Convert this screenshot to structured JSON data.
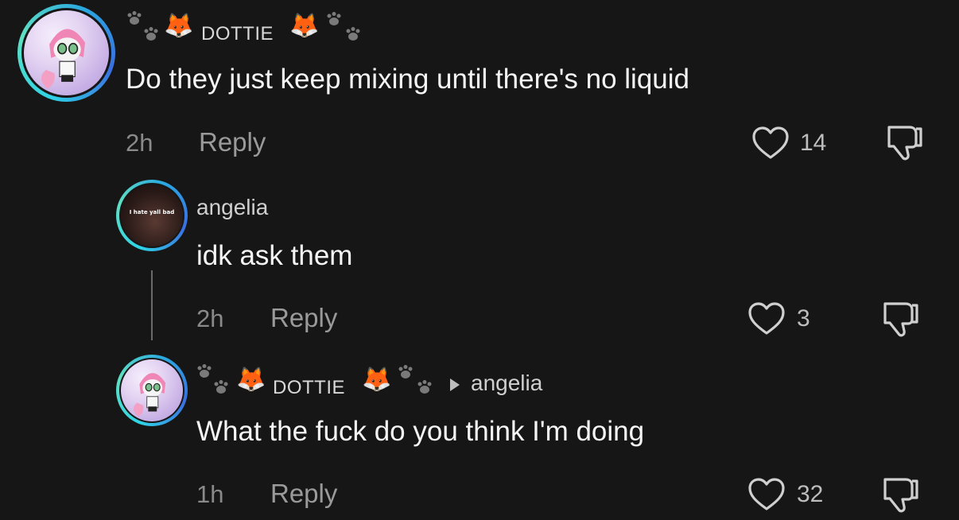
{
  "comments": [
    {
      "user": {
        "prefix_emoji": "🦊",
        "name": "DOTTIE",
        "suffix_emoji": "🦊"
      },
      "text": "Do they just keep mixing until there's no liquid",
      "time": "2h",
      "reply_label": "Reply",
      "likes": "14"
    },
    {
      "user": {
        "name": "angelia",
        "avatar_text": "I hate yall bad"
      },
      "text": "idk ask them",
      "time": "2h",
      "reply_label": "Reply",
      "likes": "3"
    },
    {
      "user": {
        "prefix_emoji": "🦊",
        "name": "DOTTIE",
        "suffix_emoji": "🦊"
      },
      "reply_to": "angelia",
      "text": "What the fuck do you think I'm doing",
      "time": "1h",
      "reply_label": "Reply",
      "likes": "32"
    }
  ],
  "colors": {
    "background": "#161616",
    "avatar_ring": "#2fd3e6"
  },
  "icons": [
    "paw-prints-icon",
    "heart-icon",
    "dislike-icon",
    "reply-to-arrow-icon"
  ]
}
